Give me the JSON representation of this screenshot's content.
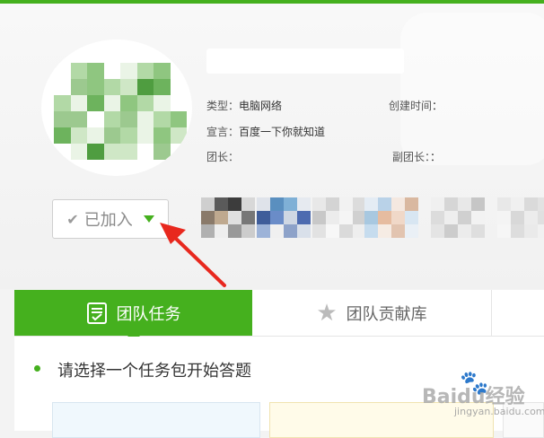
{
  "group_info": {
    "type_label": "类型：",
    "type_value": "电脑网络",
    "created_label": "创建时间",
    "created_value": "：",
    "slogan_label": "宣言：",
    "slogan_value": "百度一下你就知道",
    "leader_label": "团长：",
    "vice_leader_label": "副团长：",
    "vice_leader_value": "："
  },
  "join_button": {
    "label": "已加入",
    "check_icon": "check-icon",
    "dropdown_icon": "triangle-down-icon"
  },
  "tabs": [
    {
      "label": "团队任务",
      "icon": "task-list-icon",
      "active": true
    },
    {
      "label": "团队贡献库",
      "icon": "star-icon",
      "active": false
    }
  ],
  "content": {
    "prompt": "请选择一个任务包开始答题"
  },
  "watermark": {
    "text": "Baidu经验",
    "url": "jingyan.baidu.com"
  },
  "colors": {
    "accent": "#45b01e",
    "annotation_arrow": "#e8281e"
  }
}
